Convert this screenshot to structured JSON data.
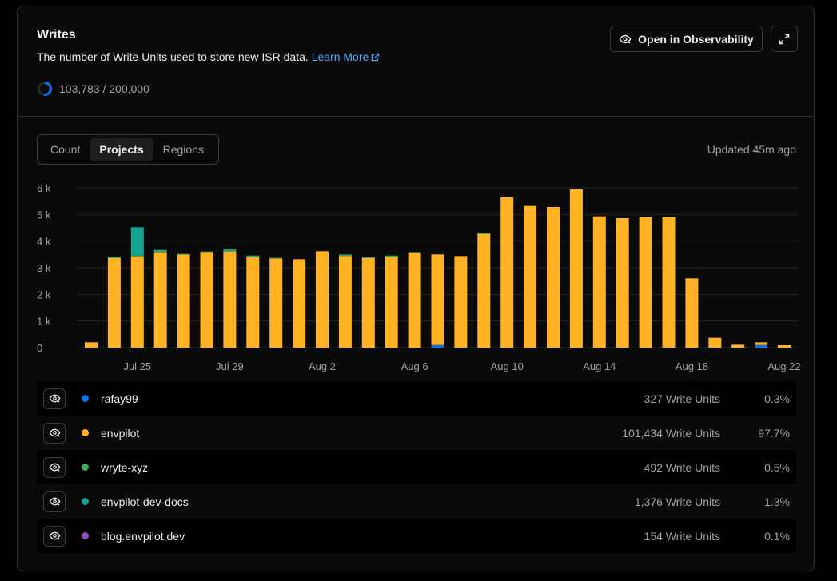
{
  "card": {
    "title": "Writes",
    "description": "The number of Write Units used to store new ISR data.",
    "learn_more": "Learn More",
    "usage_text": "103,783 / 200,000",
    "usage_fraction": 0.519,
    "open_button": "Open in Observability",
    "expand_icon": "expand-icon"
  },
  "tabs": [
    {
      "label": "Count",
      "active": false
    },
    {
      "label": "Projects",
      "active": true
    },
    {
      "label": "Regions",
      "active": false
    }
  ],
  "updated": "Updated 45m ago",
  "colors": {
    "rafay99": "#0a72ef",
    "envpilot": "#ffb224",
    "wryte-xyz": "#46a758",
    "envpilot-dev-docs": "#12a594",
    "blog.envpilot.dev": "#8e4ec6"
  },
  "chart_data": {
    "type": "bar",
    "stacked": true,
    "ylim": [
      0,
      6000
    ],
    "yticks": [
      "0",
      "1 k",
      "2 k",
      "3 k",
      "4 k",
      "5 k",
      "6 k"
    ],
    "xtick_labels": [
      {
        "index": 2,
        "label": "Jul 25"
      },
      {
        "index": 6,
        "label": "Jul 29"
      },
      {
        "index": 10,
        "label": "Aug 2"
      },
      {
        "index": 14,
        "label": "Aug 6"
      },
      {
        "index": 18,
        "label": "Aug 10"
      },
      {
        "index": 22,
        "label": "Aug 14"
      },
      {
        "index": 26,
        "label": "Aug 18"
      },
      {
        "index": 30,
        "label": "Aug 22"
      }
    ],
    "categories": [
      "Jul 23",
      "Jul 24",
      "Jul 25",
      "Jul 26",
      "Jul 27",
      "Jul 28",
      "Jul 29",
      "Jul 30",
      "Jul 31",
      "Aug 1",
      "Aug 2",
      "Aug 3",
      "Aug 4",
      "Aug 5",
      "Aug 6",
      "Aug 7",
      "Aug 8",
      "Aug 9",
      "Aug 10",
      "Aug 11",
      "Aug 12",
      "Aug 13",
      "Aug 14",
      "Aug 15",
      "Aug 16",
      "Aug 17",
      "Aug 18",
      "Aug 19",
      "Aug 20",
      "Aug 21",
      "Aug 22"
    ],
    "series": [
      {
        "name": "rafay99",
        "values": [
          0,
          0,
          0,
          0,
          0,
          0,
          0,
          0,
          0,
          0,
          0,
          0,
          0,
          0,
          0,
          100,
          0,
          0,
          0,
          0,
          0,
          0,
          0,
          0,
          0,
          0,
          0,
          0,
          0,
          100,
          0
        ]
      },
      {
        "name": "envpilot",
        "values": [
          200,
          3370,
          3430,
          3580,
          3500,
          3590,
          3600,
          3400,
          3350,
          3320,
          3620,
          3440,
          3370,
          3420,
          3570,
          3400,
          3440,
          4270,
          5640,
          5320,
          5280,
          5940,
          4930,
          4860,
          4890,
          4900,
          2600,
          370,
          110,
          100,
          90
        ]
      },
      {
        "name": "wryte-xyz",
        "values": [
          0,
          30,
          30,
          70,
          20,
          20,
          50,
          40,
          20,
          0,
          0,
          40,
          20,
          20,
          20,
          0,
          0,
          40,
          0,
          0,
          0,
          0,
          0,
          0,
          0,
          0,
          0,
          0,
          0,
          0,
          0
        ]
      },
      {
        "name": "envpilot-dev-docs",
        "values": [
          0,
          20,
          1060,
          20,
          0,
          0,
          50,
          20,
          0,
          0,
          0,
          20,
          0,
          20,
          0,
          0,
          0,
          0,
          0,
          0,
          0,
          0,
          0,
          0,
          0,
          0,
          0,
          0,
          0,
          0,
          0
        ]
      },
      {
        "name": "blog.envpilot.dev",
        "values": [
          0,
          0,
          0,
          0,
          0,
          0,
          0,
          0,
          0,
          0,
          0,
          0,
          0,
          0,
          0,
          0,
          0,
          0,
          0,
          0,
          0,
          0,
          0,
          0,
          0,
          0,
          0,
          0,
          0,
          0,
          0
        ]
      }
    ]
  },
  "rows": [
    {
      "name": "rafay99",
      "units": "327 Write Units",
      "pct": "0.3%",
      "color": "#0a72ef"
    },
    {
      "name": "envpilot",
      "units": "101,434 Write Units",
      "pct": "97.7%",
      "color": "#ffb224"
    },
    {
      "name": "wryte-xyz",
      "units": "492 Write Units",
      "pct": "0.5%",
      "color": "#46a758"
    },
    {
      "name": "envpilot-dev-docs",
      "units": "1,376 Write Units",
      "pct": "1.3%",
      "color": "#12a594"
    },
    {
      "name": "blog.envpilot.dev",
      "units": "154 Write Units",
      "pct": "0.1%",
      "color": "#8e4ec6"
    }
  ]
}
